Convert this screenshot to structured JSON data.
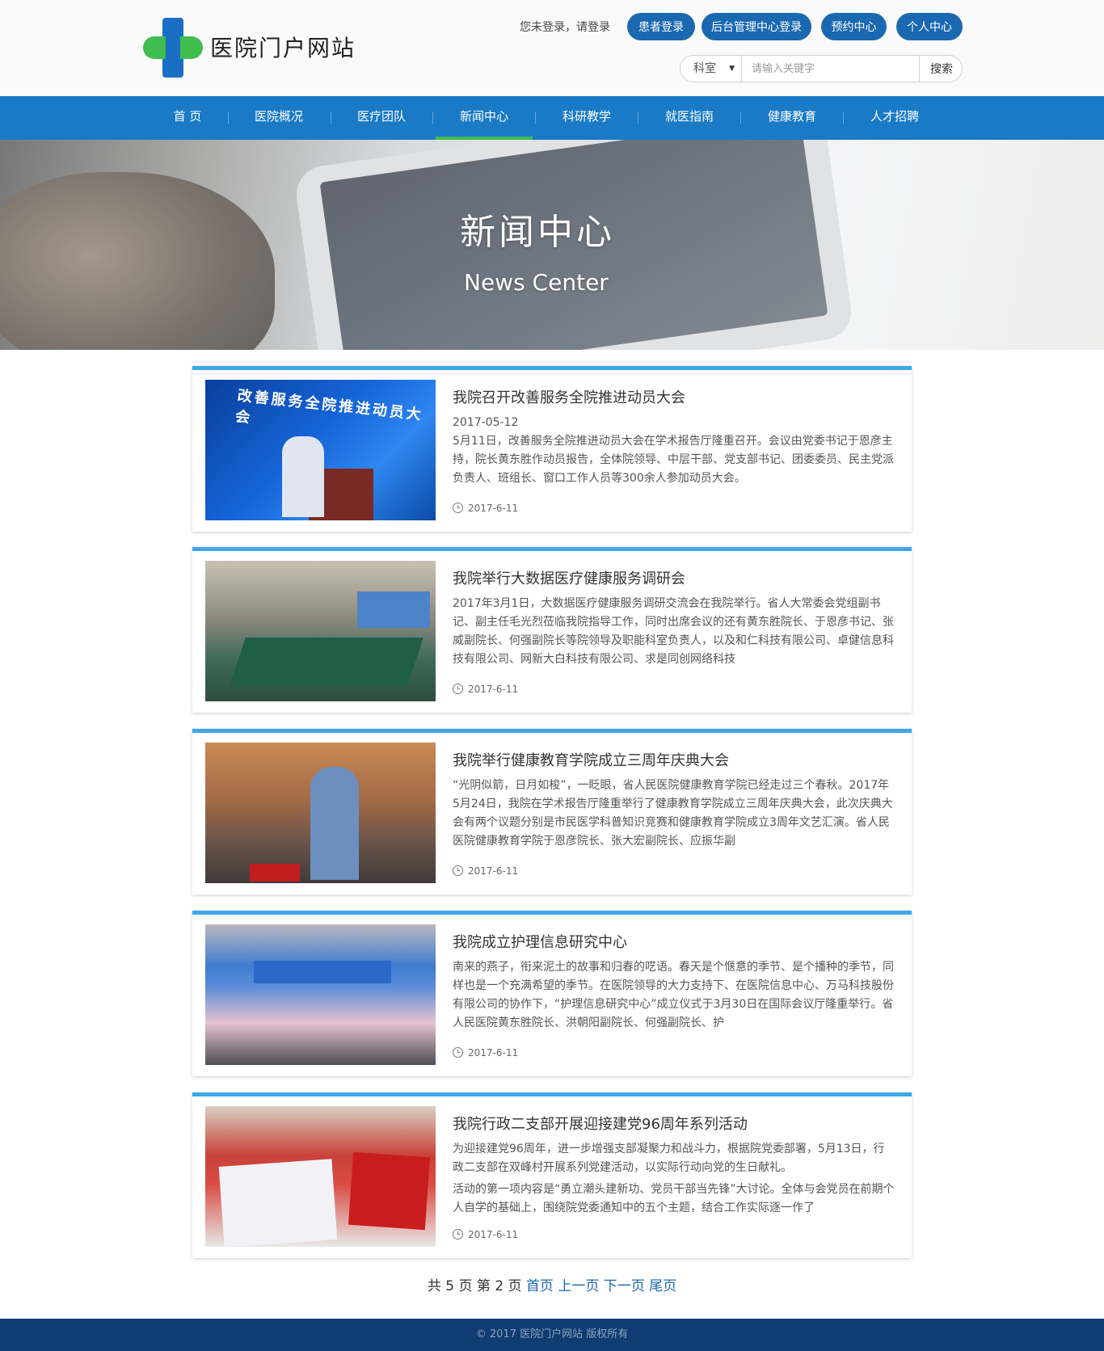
{
  "site": {
    "logo_text": "医院门户网站"
  },
  "header": {
    "login_hint": "您未登录，请登录",
    "buttons": [
      "患者登录",
      "后台管理中心登录",
      "预约中心",
      "个人中心"
    ],
    "search": {
      "dept_select": "科室",
      "placeholder": "请输入关键字",
      "button": "搜索"
    }
  },
  "nav": {
    "items": [
      "首 页",
      "医院概况",
      "医疗团队",
      "新闻中心",
      "科研教学",
      "就医指南",
      "健康教育",
      "人才招聘"
    ],
    "active": "新闻中心"
  },
  "banner": {
    "title": "新闻中心",
    "subtitle": "News Center"
  },
  "news": [
    {
      "title": "我院召开改善服务全院推进动员大会",
      "paragraphs": [
        "2017-05-12",
        "5月11日，改善服务全院推进动员大会在学术报告厅隆重召开。会议由党委书记于恩彦主持，院长黄东胜作动员报告，全体院领导、中层干部、党支部书记、团委委员、民主党派负责人、班组长、窗口工作人员等300余人参加动员大会。"
      ],
      "date": "2017-6-11",
      "thumb_caption": "改善服务全院推进动员大会"
    },
    {
      "title": "我院举行大数据医疗健康服务调研会",
      "paragraphs": [
        "2017年3月1日，大数据医疗健康服务调研交流会在我院举行。省人大常委会党组副书记、副主任毛光烈莅临我院指导工作，同时出席会议的还有黄东胜院长、于恩彦书记、张威副院长、何强副院长等院领导及职能科室负责人，以及和仁科技有限公司、卓健信息科技有限公司、网新大白科技有限公司、求是同创网络科技"
      ],
      "date": "2017-6-11"
    },
    {
      "title": "我院举行健康教育学院成立三周年庆典大会",
      "paragraphs": [
        "“光阴似箭，日月如梭”，一眨眼，省人民医院健康教育学院已经走过三个春秋。2017年5月24日，我院在学术报告厅隆重举行了健康教育学院成立三周年庆典大会，此次庆典大会有两个议题分别是市民医学科普知识竞赛和健康教育学院成立3周年文艺汇演。省人民医院健康教育学院于恩彦院长、张大宏副院长、应振华副"
      ],
      "date": "2017-6-11"
    },
    {
      "title": "我院成立护理信息研究中心",
      "paragraphs": [
        "南来的燕子，衔来泥土的故事和归春的呓语。春天是个惬意的季节、是个播种的季节，同样也是一个充满希望的季节。在医院领导的大力支持下、在医院信息中心、万马科技股份有限公司的协作下，“护理信息研究中心”成立仪式于3月30日在国际会议厅隆重举行。省人民医院黄东胜院长、洪朝阳副院长、何强副院长、护"
      ],
      "date": "2017-6-11"
    },
    {
      "title": "我院行政二支部开展迎接建党96周年系列活动",
      "paragraphs": [
        "为迎接建党96周年，进一步增强支部凝聚力和战斗力，根据院党委部署，5月13日，行政二支部在双峰村开展系列党建活动，以实际行动向党的生日献礼。",
        "活动的第一项内容是“勇立潮头建新功、党员干部当先锋”大讨论。全体与会党员在前期个人自学的基础上，围绕院党委通知中的五个主题，结合工作实际逐一作了"
      ],
      "date": "2017-6-11"
    }
  ],
  "pagination": {
    "summary": "共 5 页 第 2 页",
    "first": "首页",
    "prev": "上一页",
    "next": "下一页",
    "last": "尾页"
  },
  "footer": {
    "text": "© 2017 医院门户网站 版权所有"
  },
  "colors": {
    "primary_blue": "#1a7ac6",
    "button_blue": "#1a68b0",
    "accent_green": "#3fbd4f",
    "card_top": "#3fa6ec",
    "footer_bg": "#0e3c73"
  }
}
